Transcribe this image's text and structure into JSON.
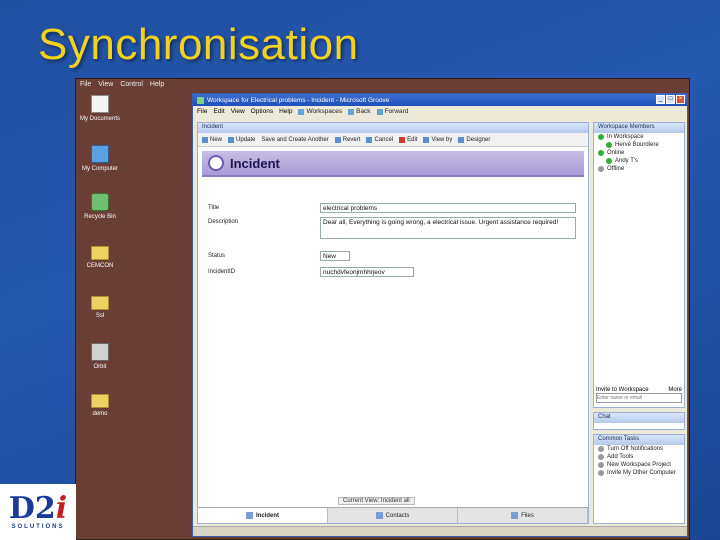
{
  "slide": {
    "title": "Synchronisation"
  },
  "desktop": {
    "menu": [
      "File",
      "View",
      "Control",
      "Help"
    ],
    "icons": [
      {
        "label": "My Documents",
        "icon": "documents-icon"
      },
      {
        "label": "My Computer",
        "icon": "computer-icon"
      },
      {
        "label": "Recycle Bin",
        "icon": "recycle-bin-icon"
      },
      {
        "label": "CEMCON",
        "icon": "folder-icon"
      },
      {
        "label": "Ssl",
        "icon": "folder-icon"
      },
      {
        "label": "Orbit",
        "icon": "network-icon"
      },
      {
        "label": "demo",
        "icon": "folder-icon"
      }
    ]
  },
  "app": {
    "window_title": "Workspace for Electrical problems - Incident - Microsoft Groove",
    "menu": [
      "File",
      "Edit",
      "View",
      "Options",
      "Help"
    ],
    "menu_tools": [
      "Workspaces",
      "Back",
      "Forward"
    ],
    "pane_title": "Incident",
    "toolbar": [
      "New",
      "Update",
      "Save and Create Another",
      "Revert",
      "Cancel",
      "Edit",
      "View by",
      "Designer"
    ],
    "form": {
      "title": "Incident",
      "fields": [
        {
          "label": "Title",
          "value": "electrical problems"
        },
        {
          "label": "Description",
          "value": "Dear all, Everything is going wrong, a electrical issue. Urgent assistance required!"
        },
        {
          "label": "Status",
          "value": "New"
        },
        {
          "label": "IncidentID",
          "value": "nuchdvfeonjmhhrjeov"
        }
      ]
    },
    "stage_bar": "Current View: Incident all",
    "tabs": [
      "Incident",
      "Contacts",
      "Files"
    ],
    "members": {
      "title": "Workspace Members",
      "groups": [
        {
          "label": "In Workspace",
          "people": [
            "Hervé Bourdiere"
          ]
        },
        {
          "label": "Online",
          "people": [
            "Andy T's"
          ]
        },
        {
          "label": "Offline",
          "people": []
        }
      ]
    },
    "invite": {
      "label": "Invite to Workspace",
      "placeholder": "Enter name or email",
      "more": "More"
    },
    "chat": {
      "title": "Chat"
    },
    "tasks": {
      "title": "Common Tasks",
      "items": [
        "Turn Off Notifications",
        "Add Tools",
        "New Workspace Project",
        "Invite My Other Computer"
      ]
    }
  },
  "logo": {
    "mark": "D2i",
    "sub": "SOLUTIONS"
  }
}
